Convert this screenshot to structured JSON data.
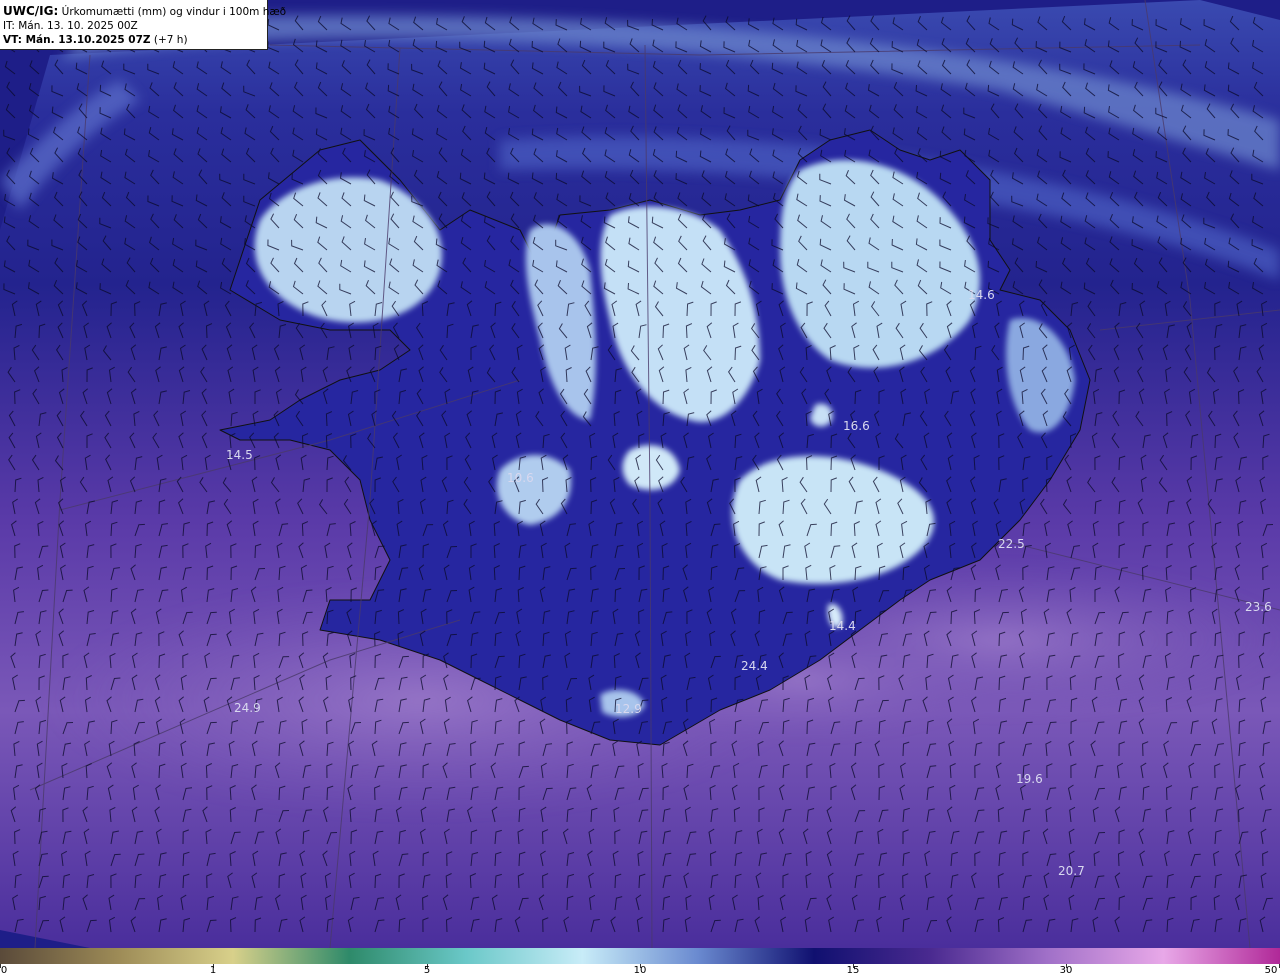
{
  "header": {
    "product": "UWC/IG:",
    "title": "Úrkomumætti (mm) og vindur i 100m hæð",
    "it_line": "IT: Mán. 13. 10. 2025 00Z",
    "vt_bold": "VT: Mán. 13.10.2025 07Z",
    "vt_lead": "(+7 h)"
  },
  "map": {
    "colors": {
      "sea_north": "#2a2ea0",
      "sea_deep": "#1a1a8a",
      "sea_south": "#7a5cb8",
      "land_high": "#c8e4f4",
      "coastline": "#111111"
    },
    "value_labels": [
      {
        "id": "v1",
        "text": "14.5"
      },
      {
        "id": "v2",
        "text": "10.6"
      },
      {
        "id": "v3",
        "text": "16.6"
      },
      {
        "id": "v4",
        "text": "22.5"
      },
      {
        "id": "v5",
        "text": "23.6"
      },
      {
        "id": "v6",
        "text": "14.4"
      },
      {
        "id": "v7",
        "text": "24.4"
      },
      {
        "id": "v8",
        "text": "12.9"
      },
      {
        "id": "v9",
        "text": "24.9"
      },
      {
        "id": "v10",
        "text": "19.6"
      },
      {
        "id": "v11",
        "text": "20.7"
      },
      {
        "id": "v12",
        "text": "14.6"
      }
    ]
  },
  "colorbar": {
    "ticks": [
      "0",
      "1",
      "5",
      "10",
      "15",
      "30",
      "50"
    ],
    "colors": [
      "#5a4a3a",
      "#9c8a56",
      "#d8d08a",
      "#2e8a6a",
      "#6ac8c8",
      "#c8ecf8",
      "#6a8ad0",
      "#101070",
      "#4a2a90",
      "#a070c8",
      "#e8a8e8",
      "#b02898"
    ]
  }
}
